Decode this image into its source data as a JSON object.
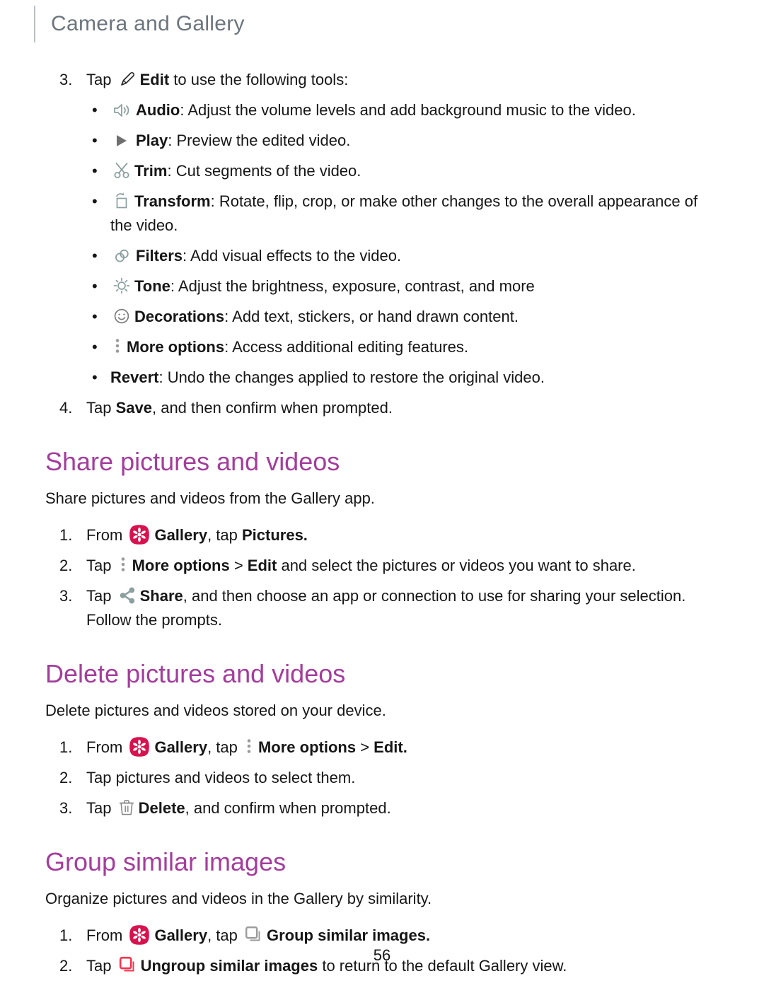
{
  "header": {
    "title": "Camera and Gallery"
  },
  "colors": {
    "heading": "#a43d9c",
    "header_text": "#6c757d",
    "icon_teal_gray": "#8c9fa1",
    "icon_dark_gray": "#6f6f6f",
    "gallery_red": "#d8114f",
    "ungroup_red": "#f5334f",
    "body_text": "#161616"
  },
  "edit_tools_step": {
    "number": "3.",
    "prefix": "Tap ",
    "icon": "pencil-edit-icon",
    "bold_label": "Edit",
    "suffix": " to use the following tools:"
  },
  "tools": [
    {
      "icon": "speaker-audio-icon",
      "label": "Audio",
      "text": ": Adjust the volume levels and add background music to the video."
    },
    {
      "icon": "play-triangle-icon",
      "label": "Play",
      "text": ": Preview the edited video."
    },
    {
      "icon": "scissors-trim-icon",
      "label": "Trim",
      "text": ": Cut segments of the video."
    },
    {
      "icon": "transform-rotate-icon",
      "label": "Transform",
      "text": ": Rotate, flip, crop, or make other changes to the overall appearance of the video."
    },
    {
      "icon": "filters-circles-icon",
      "label": "Filters",
      "text": ": Add visual effects to the video."
    },
    {
      "icon": "tone-sun-icon",
      "label": "Tone",
      "text": ": Adjust the brightness, exposure, contrast, and more"
    },
    {
      "icon": "decorations-smiley-icon",
      "label": "Decorations",
      "text": ": Add text, stickers, or hand drawn content."
    },
    {
      "icon": "more-options-dots-icon",
      "label": "More options",
      "text": ": Access additional editing features."
    },
    {
      "icon": "",
      "label": "Revert",
      "text": ": Undo the changes applied to restore the original video."
    }
  ],
  "save_step": {
    "number": "4.",
    "prefix": "Tap ",
    "bold_label": "Save",
    "suffix": ", and then confirm when prompted."
  },
  "sections": [
    {
      "id": "share",
      "title": "Share pictures and videos",
      "intro": "Share pictures and videos from the Gallery app.",
      "steps": [
        {
          "number": "1.",
          "parts": [
            {
              "type": "text",
              "value": "From "
            },
            {
              "type": "icon",
              "value": "gallery-app-icon"
            },
            {
              "type": "bold",
              "value": "Gallery"
            },
            {
              "type": "text",
              "value": ", tap "
            },
            {
              "type": "bold",
              "value": "Pictures."
            }
          ]
        },
        {
          "number": "2.",
          "parts": [
            {
              "type": "text",
              "value": "Tap "
            },
            {
              "type": "icon",
              "value": "more-options-dots-icon"
            },
            {
              "type": "bold",
              "value": "More options"
            },
            {
              "type": "text",
              "value": " > "
            },
            {
              "type": "bold",
              "value": "Edit"
            },
            {
              "type": "text",
              "value": " and select the pictures or videos you want to share."
            }
          ]
        },
        {
          "number": "3.",
          "parts": [
            {
              "type": "text",
              "value": "Tap "
            },
            {
              "type": "icon",
              "value": "share-nodes-icon"
            },
            {
              "type": "bold",
              "value": "Share"
            },
            {
              "type": "text",
              "value": ", and then choose an app or connection to use for sharing your selection. Follow the prompts."
            }
          ]
        }
      ]
    },
    {
      "id": "delete",
      "title": "Delete pictures and videos",
      "intro": "Delete pictures and videos stored on your device.",
      "steps": [
        {
          "number": "1.",
          "parts": [
            {
              "type": "text",
              "value": "From "
            },
            {
              "type": "icon",
              "value": "gallery-app-icon"
            },
            {
              "type": "bold",
              "value": "Gallery"
            },
            {
              "type": "text",
              "value": ", tap "
            },
            {
              "type": "icon",
              "value": "more-options-dots-icon"
            },
            {
              "type": "bold",
              "value": "More options"
            },
            {
              "type": "text",
              "value": " > "
            },
            {
              "type": "bold",
              "value": "Edit."
            }
          ]
        },
        {
          "number": "2.",
          "parts": [
            {
              "type": "text",
              "value": "Tap pictures and videos to select them."
            }
          ]
        },
        {
          "number": "3.",
          "parts": [
            {
              "type": "text",
              "value": "Tap "
            },
            {
              "type": "icon",
              "value": "trash-delete-icon"
            },
            {
              "type": "bold",
              "value": "Delete"
            },
            {
              "type": "text",
              "value": ", and confirm when prompted."
            }
          ]
        }
      ]
    },
    {
      "id": "group",
      "title": "Group similar images",
      "intro": "Organize pictures and videos in the Gallery by similarity.",
      "steps": [
        {
          "number": "1.",
          "parts": [
            {
              "type": "text",
              "value": "From "
            },
            {
              "type": "icon",
              "value": "gallery-app-icon"
            },
            {
              "type": "bold",
              "value": "Gallery"
            },
            {
              "type": "text",
              "value": ", tap "
            },
            {
              "type": "icon",
              "value": "group-similar-images-icon"
            },
            {
              "type": "bold",
              "value": "Group similar images."
            }
          ]
        },
        {
          "number": "2.",
          "parts": [
            {
              "type": "text",
              "value": "Tap "
            },
            {
              "type": "icon",
              "value": "ungroup-similar-images-icon"
            },
            {
              "type": "bold",
              "value": "Ungroup similar images"
            },
            {
              "type": "text",
              "value": " to return to the default Gallery view."
            }
          ]
        }
      ]
    }
  ],
  "footer": {
    "page_number": "56"
  }
}
